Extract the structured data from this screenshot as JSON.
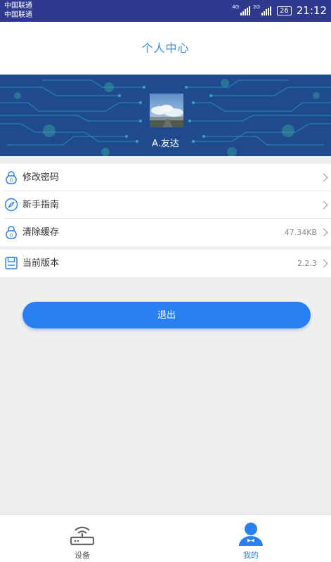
{
  "status_bar": {
    "carrier_1": "中国联通",
    "carrier_2": "中国联通",
    "network_1": "4G",
    "network_2": "2G",
    "battery": "26",
    "time": "21:12"
  },
  "header": {
    "title": "个人中心"
  },
  "profile": {
    "username": "A.友达",
    "avatar_icon": "avatar-photo"
  },
  "menu": {
    "items": [
      {
        "label": "修改密码",
        "icon": "lock-icon",
        "value": ""
      },
      {
        "label": "新手指南",
        "icon": "compass-icon",
        "value": ""
      },
      {
        "label": "清除缓存",
        "icon": "lock-icon",
        "value": "47.34KB"
      }
    ],
    "version": {
      "label": "当前版本",
      "icon": "save-icon",
      "value": "2.2.3"
    }
  },
  "logout": {
    "label": "退出"
  },
  "tabbar": {
    "tabs": [
      {
        "label": "设备",
        "icon": "router-icon",
        "active": false
      },
      {
        "label": "我的",
        "icon": "user-icon",
        "active": true
      }
    ]
  },
  "colors": {
    "accent": "#2a7ff0",
    "status_bar": "#2f3a8f",
    "banner": "#1f4a8e"
  }
}
